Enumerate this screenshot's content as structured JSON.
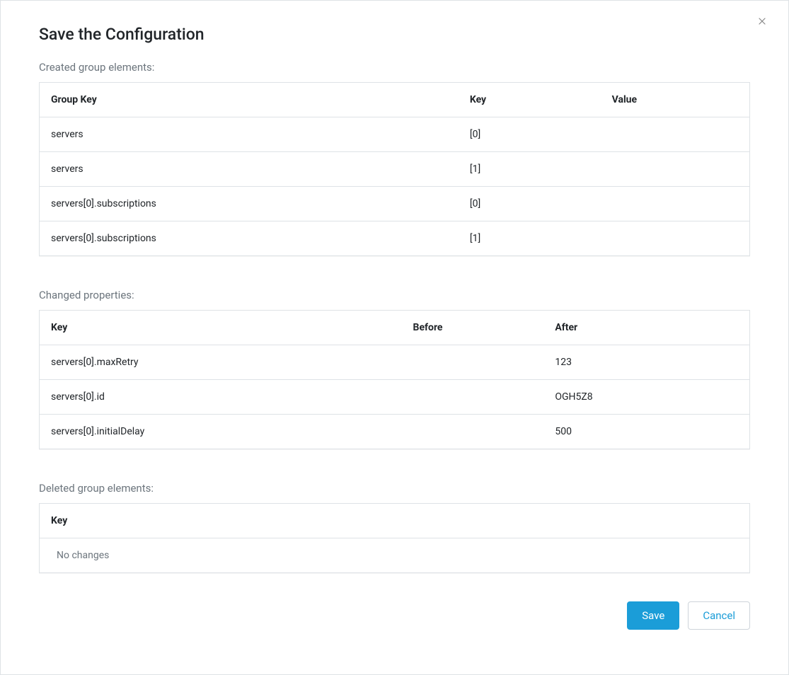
{
  "modal": {
    "title": "Save the Configuration"
  },
  "created": {
    "label": "Created group elements:",
    "headers": {
      "groupKey": "Group Key",
      "key": "Key",
      "value": "Value"
    },
    "rows": [
      {
        "groupKey": "servers",
        "key": "[0]",
        "value": ""
      },
      {
        "groupKey": "servers",
        "key": "[1]",
        "value": ""
      },
      {
        "groupKey": "servers[0].subscriptions",
        "key": "[0]",
        "value": ""
      },
      {
        "groupKey": "servers[0].subscriptions",
        "key": "[1]",
        "value": ""
      }
    ]
  },
  "changed": {
    "label": "Changed properties:",
    "headers": {
      "key": "Key",
      "before": "Before",
      "after": "After"
    },
    "rows": [
      {
        "key": "servers[0].maxRetry",
        "before": "",
        "after": "123"
      },
      {
        "key": "servers[0].id",
        "before": "",
        "after": "OGH5Z8"
      },
      {
        "key": "servers[0].initialDelay",
        "before": "",
        "after": "500"
      }
    ]
  },
  "deleted": {
    "label": "Deleted group elements:",
    "headers": {
      "key": "Key"
    },
    "empty": "No changes"
  },
  "footer": {
    "save": "Save",
    "cancel": "Cancel"
  }
}
